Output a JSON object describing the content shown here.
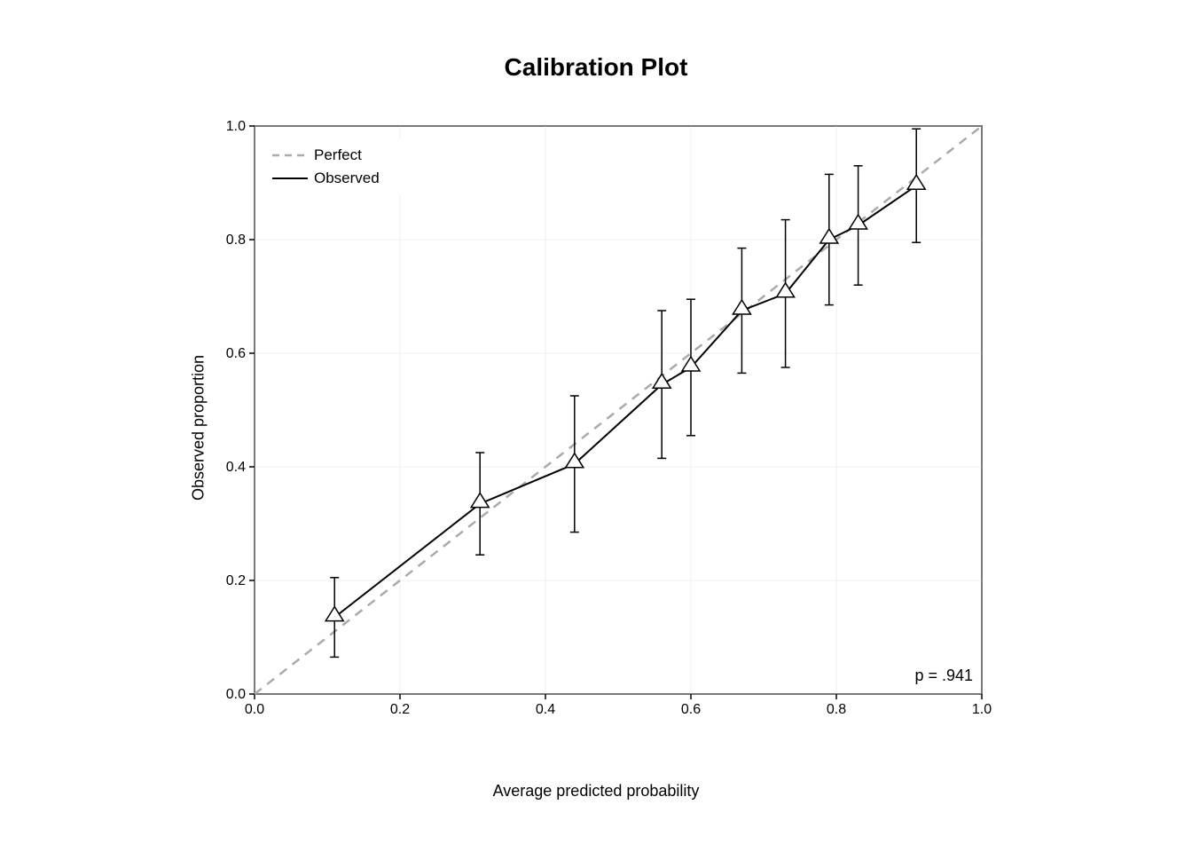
{
  "title": "Calibration Plot",
  "x_axis_label": "Average predicted probability",
  "y_axis_label": "Observed proportion",
  "x_ticks": [
    "0.0",
    "0.2",
    "0.4",
    "0.6",
    "0.8",
    "1.0"
  ],
  "y_ticks": [
    "0.0",
    "0.2",
    "0.4",
    "0.6",
    "0.8",
    "1.0"
  ],
  "p_value": "p = .941",
  "legend": {
    "perfect_label": "Perfect",
    "observed_label": "Observed"
  },
  "data_points": [
    {
      "x": 0.11,
      "y": 0.135,
      "y_low": 0.065,
      "y_high": 0.205
    },
    {
      "x": 0.31,
      "y": 0.335,
      "y_low": 0.245,
      "y_high": 0.425
    },
    {
      "x": 0.44,
      "y": 0.405,
      "y_low": 0.285,
      "y_high": 0.525
    },
    {
      "x": 0.56,
      "y": 0.545,
      "y_low": 0.415,
      "y_high": 0.675
    },
    {
      "x": 0.6,
      "y": 0.575,
      "y_low": 0.455,
      "y_high": 0.695
    },
    {
      "x": 0.67,
      "y": 0.675,
      "y_low": 0.565,
      "y_high": 0.785
    },
    {
      "x": 0.73,
      "y": 0.705,
      "y_low": 0.575,
      "y_high": 0.835
    },
    {
      "x": 0.79,
      "y": 0.8,
      "y_low": 0.685,
      "y_high": 0.915
    },
    {
      "x": 0.83,
      "y": 0.825,
      "y_low": 0.72,
      "y_high": 0.93
    },
    {
      "x": 0.91,
      "y": 0.895,
      "y_low": 0.795,
      "y_high": 0.995
    }
  ],
  "colors": {
    "perfect_line": "#aaaaaa",
    "observed_line": "#000000",
    "error_bar": "#000000",
    "triangle": "#000000",
    "background": "#ffffff",
    "axis": "#000000"
  }
}
